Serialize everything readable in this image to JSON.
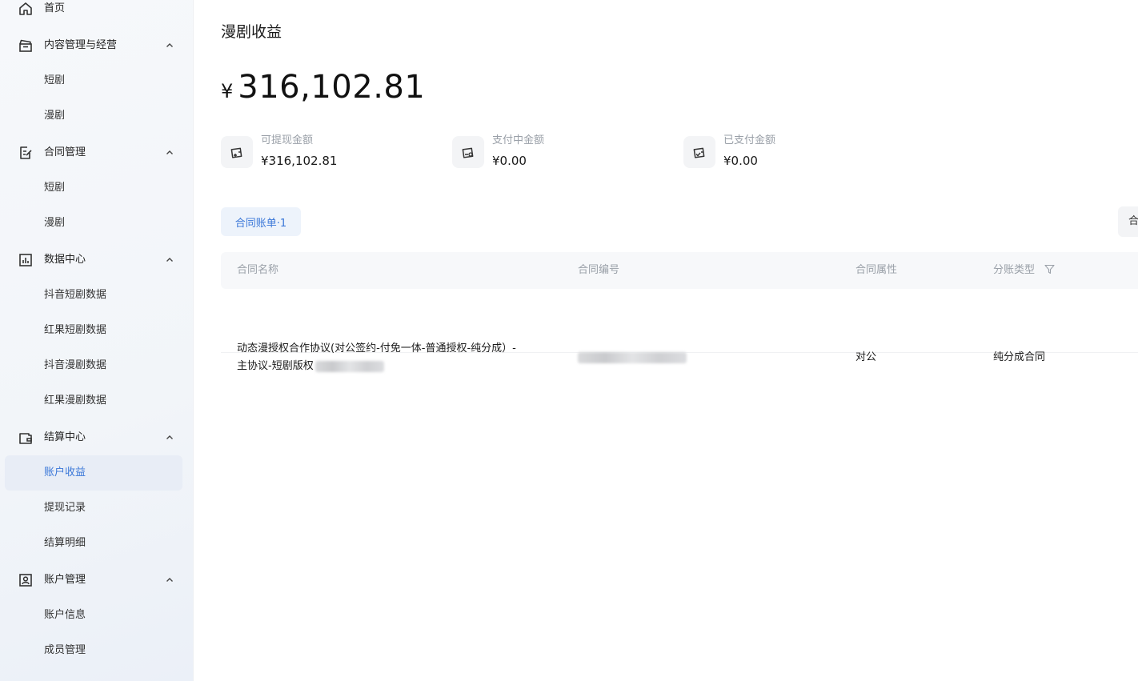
{
  "sidebar": {
    "home": {
      "label": "首页",
      "icon": "home-icon"
    },
    "groups": [
      {
        "key": "content",
        "label": "内容管理与经营",
        "icon": "clapperboard-icon",
        "children": [
          "短剧",
          "漫剧"
        ]
      },
      {
        "key": "contract",
        "label": "合同管理",
        "icon": "contract-edit-icon",
        "children": [
          "短剧",
          "漫剧"
        ]
      },
      {
        "key": "data",
        "label": "数据中心",
        "icon": "bar-chart-icon",
        "children": [
          "抖音短剧数据",
          "红果短剧数据",
          "抖音漫剧数据",
          "红果漫剧数据"
        ]
      },
      {
        "key": "settle",
        "label": "结算中心",
        "icon": "wallet-icon",
        "children": [
          "账户收益",
          "提现记录",
          "结算明细"
        ],
        "active_child": 0
      },
      {
        "key": "account",
        "label": "账户管理",
        "icon": "user-card-icon",
        "children": [
          "账户信息",
          "成员管理"
        ]
      }
    ]
  },
  "main": {
    "title": "漫剧收益",
    "total": {
      "currency": "¥",
      "amount": "316,102.81"
    },
    "stats": [
      {
        "label": "可提现金额",
        "value": "¥316,102.81",
        "icon": "wallet-withdraw-icon"
      },
      {
        "label": "支付中金额",
        "value": "¥0.00",
        "icon": "wallet-pending-icon"
      },
      {
        "label": "已支付金额",
        "value": "¥0.00",
        "icon": "wallet-paid-icon"
      }
    ],
    "tab": "合同账单·1",
    "right_button": "合",
    "table": {
      "columns": [
        "合同名称",
        "合同编号",
        "合同属性",
        "分账类型"
      ],
      "rows": [
        {
          "name_line1": "动态漫授权合作协议(对公签约-付免一体-普通授权-纯分成）-",
          "name_line2": "主协议-短剧版权",
          "attribute": "对公",
          "split_type": "纯分成合同"
        }
      ]
    }
  },
  "colors": {
    "accent": "#3a77d8",
    "active_bg": "#e8edf6",
    "muted_text": "#9aa0a8"
  }
}
